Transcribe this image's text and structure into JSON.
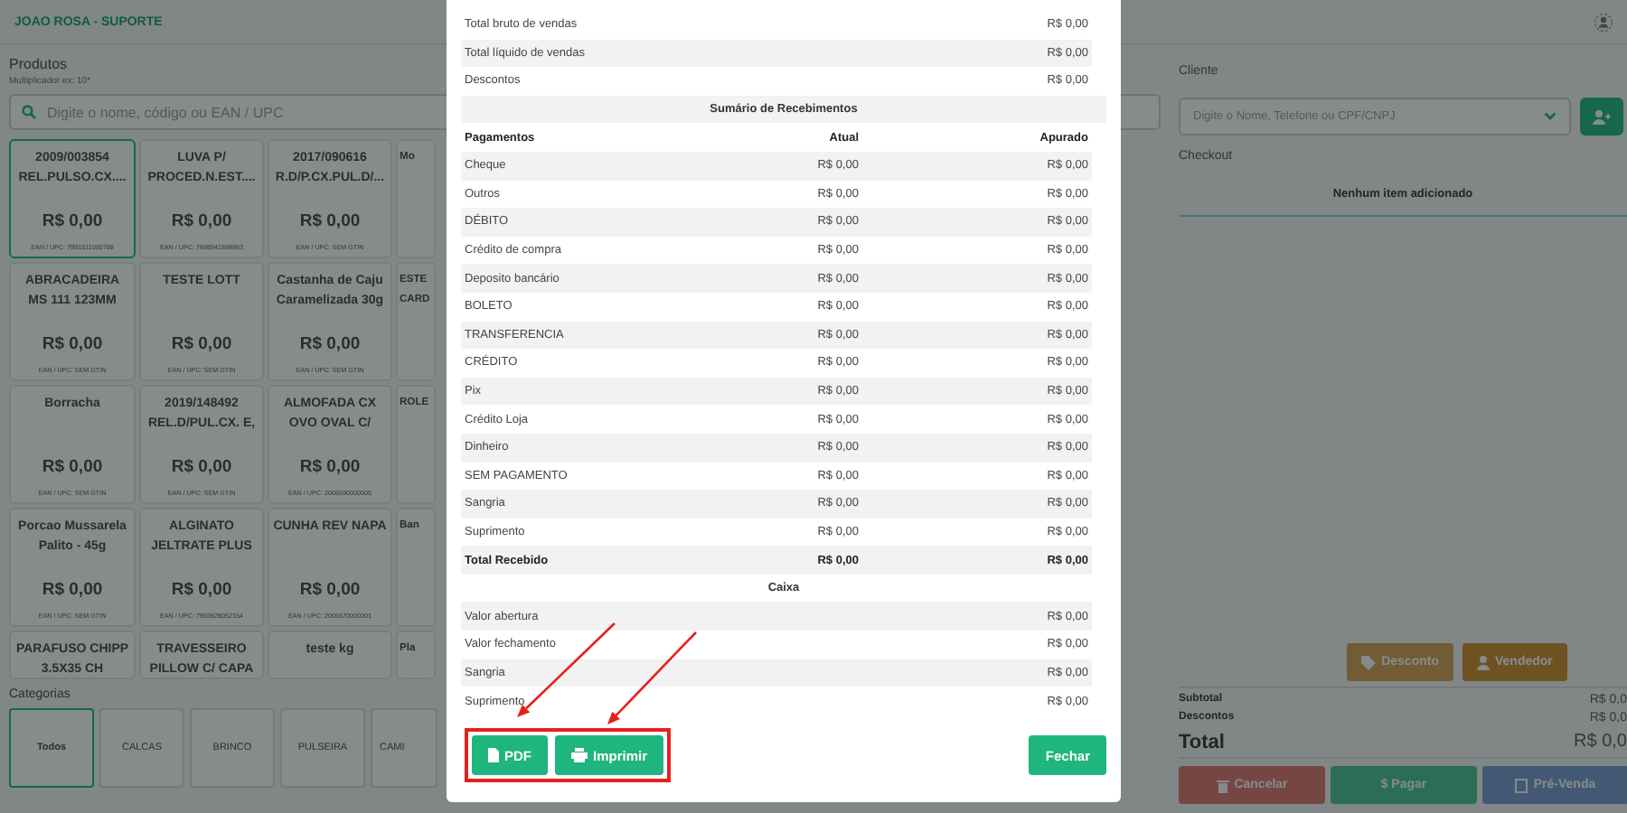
{
  "header": {
    "store": "JOAO ROSA - SUPORTE"
  },
  "products": {
    "title": "Produtos",
    "hint": "Multiplicador ex: 10*",
    "search_placeholder": "Digite o nome, código ou EAN / UPC",
    "rows": [
      [
        {
          "name": "2009/003854 REL.PULSO.CX....",
          "price": "R$ 0,00",
          "code": "EAN / UPC: 7891511090788",
          "selected": true
        },
        {
          "name": "LUVA P/ PROCED.N.EST....",
          "price": "R$ 0,00",
          "code": "EAN / UPC: 7898941898953",
          "selected": false
        },
        {
          "name": "2017/090616 R.D/P.CX.PUL.D/...",
          "price": "R$ 0,00",
          "code": "EAN / UPC: SEM GTIN",
          "selected": false
        },
        {
          "name": "Mo",
          "selected": false
        }
      ],
      [
        {
          "name": "ABRACADEIRA MS 111 123MM",
          "price": "R$ 0,00",
          "code": "EAN / UPC: SEM GTIN",
          "selected": false
        },
        {
          "name": "TESTE LOTT",
          "price": "R$ 0,00",
          "code": "EAN / UPC: SEM GTIN",
          "selected": false
        },
        {
          "name": "Castanha de Caju Caramelizada 30g",
          "price": "R$ 0,00",
          "code": "EAN / UPC: SEM GTIN",
          "selected": false
        },
        {
          "name": "ESTE CARD",
          "selected": false
        }
      ],
      [
        {
          "name": "Borracha",
          "price": "R$ 0,00",
          "code": "EAN / UPC: SEM GTIN",
          "selected": false
        },
        {
          "name": "2019/148492 REL.D/PUL.CX. E,",
          "price": "R$ 0,00",
          "code": "EAN / UPC: SEM GTIN",
          "selected": false
        },
        {
          "name": "ALMOFADA CX OVO OVAL C/",
          "price": "R$ 0,00",
          "code": "EAN / UPC: 2006690000005",
          "selected": false
        },
        {
          "name": "ROLE",
          "selected": false
        }
      ],
      [
        {
          "name": "Porcao Mussarela Palito - 45g",
          "price": "R$ 0,00",
          "code": "EAN / UPC: SEM GTIN",
          "selected": false
        },
        {
          "name": "ALGINATO JELTRATE PLUS",
          "price": "R$ 0,00",
          "code": "EAN / UPC: 7893628052154",
          "selected": false
        },
        {
          "name": "CUNHA REV NAPA",
          "price": "R$ 0,00",
          "code": "EAN / UPC: 2006670000001",
          "selected": false
        },
        {
          "name": "Ban",
          "selected": false
        }
      ],
      [
        {
          "name": "PARAFUSO CHIPP 3.5X35 CH",
          "selected": false
        },
        {
          "name": "TRAVESSEIRO PILLOW C/ CAPA",
          "selected": false
        },
        {
          "name": "teste kg",
          "selected": false
        },
        {
          "name": "Pla",
          "selected": false
        }
      ]
    ]
  },
  "categories": {
    "title": "Categorias",
    "items": [
      {
        "label": "Todos",
        "selected": true
      },
      {
        "label": "CALCAS",
        "selected": false
      },
      {
        "label": "BRINCO",
        "selected": false
      },
      {
        "label": "PULSEIRA",
        "selected": false
      },
      {
        "label": "CAMI",
        "selected": false
      }
    ]
  },
  "client": {
    "title": "Cliente",
    "placeholder": "Digite o Nome, Telefone ou CPF/CNPJ"
  },
  "checkout": {
    "title": "Checkout",
    "empty": "Nenhum item adicionado",
    "buttons": [
      {
        "label": "Desconto",
        "kind": "warning",
        "disabled": true
      },
      {
        "label": "Vendedor",
        "kind": "warning",
        "disabled": false
      }
    ],
    "subtotal": {
      "label": "Subtotal",
      "value": "R$ 0,0"
    },
    "discounts": {
      "label": "Descontos",
      "value": "R$ 0,0"
    },
    "total": {
      "label": "Total",
      "value": "R$ 0,0"
    },
    "actions": [
      {
        "label": "Cancelar",
        "kind": "danger",
        "disabled": true
      },
      {
        "label": "$ Pagar",
        "kind": "success",
        "disabled": true
      },
      {
        "label": "Pré-Venda",
        "kind": "info",
        "disabled": true
      }
    ]
  },
  "modal": {
    "summary": [
      {
        "label": "Total bruto de vendas",
        "value": "R$ 0,00"
      },
      {
        "label": "Total líquido de vendas",
        "value": "R$ 0,00"
      },
      {
        "label": "Descontos",
        "value": "R$ 0,00"
      }
    ],
    "receipts": {
      "title": "Sumário de Recebimentos",
      "columns": [
        "Pagamentos",
        "Atual",
        "Apurado"
      ],
      "rows": [
        {
          "label": "Cheque",
          "current": "R$ 0,00",
          "counted": "R$ 0,00",
          "total": false
        },
        {
          "label": "Outros",
          "current": "R$ 0,00",
          "counted": "R$ 0,00",
          "total": false
        },
        {
          "label": "DÉBITO",
          "current": "R$ 0,00",
          "counted": "R$ 0,00",
          "total": false
        },
        {
          "label": "Crédito de compra",
          "current": "R$ 0,00",
          "counted": "R$ 0,00",
          "total": false
        },
        {
          "label": "Deposito bancário",
          "current": "R$ 0,00",
          "counted": "R$ 0,00",
          "total": false
        },
        {
          "label": "BOLETO",
          "current": "R$ 0,00",
          "counted": "R$ 0,00",
          "total": false
        },
        {
          "label": "TRANSFERENCIA",
          "current": "R$ 0,00",
          "counted": "R$ 0,00",
          "total": false
        },
        {
          "label": "CRÉDITO",
          "current": "R$ 0,00",
          "counted": "R$ 0,00",
          "total": false
        },
        {
          "label": "Pix",
          "current": "R$ 0,00",
          "counted": "R$ 0,00",
          "total": false
        },
        {
          "label": "Crédito Loja",
          "current": "R$ 0,00",
          "counted": "R$ 0,00",
          "total": false
        },
        {
          "label": "Dinheiro",
          "current": "R$ 0,00",
          "counted": "R$ 0,00",
          "total": false
        },
        {
          "label": "SEM PAGAMENTO",
          "current": "R$ 0,00",
          "counted": "R$ 0,00",
          "total": false
        },
        {
          "label": "Sangria",
          "current": "R$ 0,00",
          "counted": "R$ 0,00",
          "total": false
        },
        {
          "label": "Suprimento",
          "current": "R$ 0,00",
          "counted": "R$ 0,00",
          "total": false
        },
        {
          "label": "Total Recebido",
          "current": "R$ 0,00",
          "counted": "R$ 0,00",
          "total": true
        }
      ]
    },
    "cash": {
      "title": "Caixa",
      "rows": [
        {
          "label": "Valor abertura",
          "value": "R$ 0,00"
        },
        {
          "label": "Valor fechamento",
          "value": "R$ 0,00"
        },
        {
          "label": "Sangria",
          "value": "R$ 0,00"
        },
        {
          "label": "Suprimento",
          "value": "R$ 0,00"
        }
      ]
    },
    "buttons": [
      {
        "label": "PDF",
        "kind": "pdf"
      },
      {
        "label": "Imprimir",
        "kind": "print"
      },
      {
        "label": "Fechar",
        "kind": "close"
      }
    ]
  }
}
